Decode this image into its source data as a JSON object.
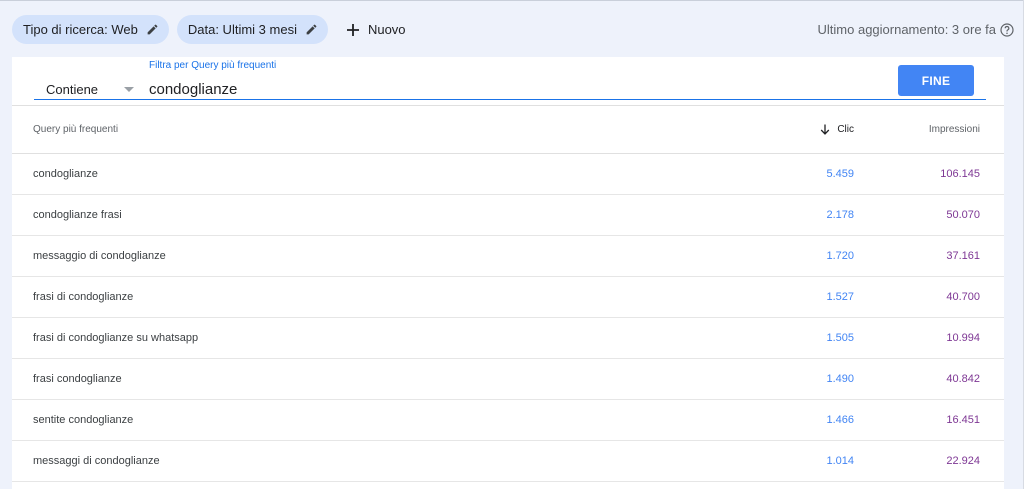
{
  "filters": {
    "chips": [
      {
        "label": "Tipo di ricerca: Web",
        "icon": "pencil-icon"
      },
      {
        "label": "Data: Ultimi 3 mesi",
        "icon": "pencil-icon"
      }
    ],
    "new_label": "Nuovo",
    "last_update": "Ultimo aggiornamento: 3 ore fa"
  },
  "query_filter": {
    "operator": "Contiene",
    "field_label": "Filtra per Query più frequenti",
    "value": "condoglianze",
    "done_label": "FINE"
  },
  "table": {
    "columns": {
      "query": "Query più frequenti",
      "clicks": "Clic",
      "impressions": "Impressioni"
    },
    "rows": [
      {
        "query": "condoglianze",
        "clicks": "5.459",
        "impressions": "106.145"
      },
      {
        "query": "condoglianze frasi",
        "clicks": "2.178",
        "impressions": "50.070"
      },
      {
        "query": "messaggio di condoglianze",
        "clicks": "1.720",
        "impressions": "37.161"
      },
      {
        "query": "frasi di condoglianze",
        "clicks": "1.527",
        "impressions": "40.700"
      },
      {
        "query": "frasi di condoglianze su whatsapp",
        "clicks": "1.505",
        "impressions": "10.994"
      },
      {
        "query": "frasi condoglianze",
        "clicks": "1.490",
        "impressions": "40.842"
      },
      {
        "query": "sentite condoglianze",
        "clicks": "1.466",
        "impressions": "16.451"
      },
      {
        "query": "messaggi di condoglianze",
        "clicks": "1.014",
        "impressions": "22.924"
      }
    ]
  },
  "colors": {
    "clicks": "#4285f4",
    "impressions": "#7e3794",
    "accent": "#1a73e8",
    "chip_bg": "#d3e2fb"
  }
}
